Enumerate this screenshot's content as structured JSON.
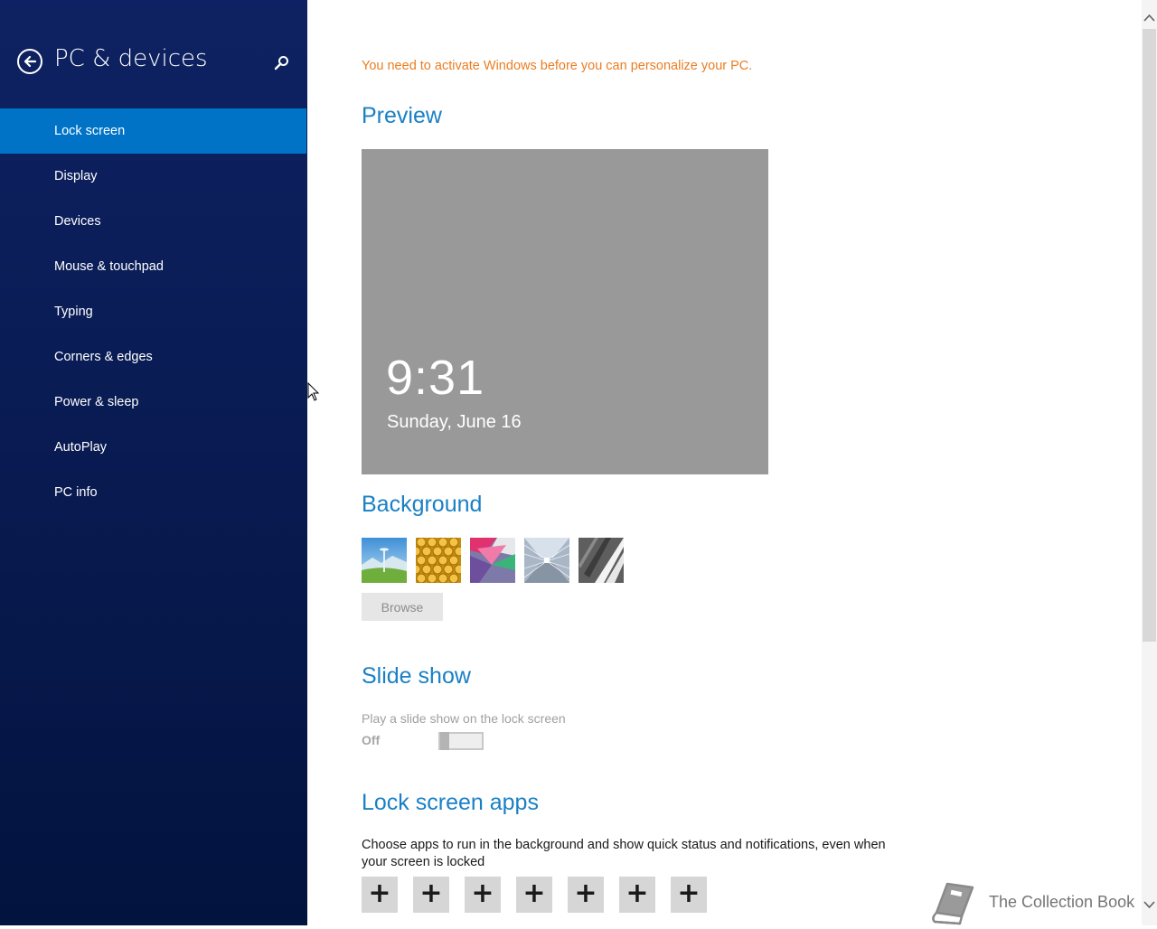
{
  "sidebar": {
    "title": "PC & devices",
    "items": [
      {
        "label": "Lock screen",
        "selected": true
      },
      {
        "label": "Display"
      },
      {
        "label": "Devices"
      },
      {
        "label": "Mouse & touchpad"
      },
      {
        "label": "Typing"
      },
      {
        "label": "Corners & edges"
      },
      {
        "label": "Power & sleep"
      },
      {
        "label": "AutoPlay"
      },
      {
        "label": "PC info"
      }
    ]
  },
  "main": {
    "activation_warning": "You need to activate Windows before you can personalize your PC.",
    "preview": {
      "heading": "Preview",
      "time": "9:31",
      "date": "Sunday, June 16"
    },
    "background": {
      "heading": "Background",
      "thumbnails": [
        "space-needle-landscape",
        "honeycomb",
        "geometric-shapes",
        "glass-tunnel",
        "piano-keys"
      ],
      "browse_label": "Browse"
    },
    "slide_show": {
      "heading": "Slide show",
      "description": "Play a slide show on the lock screen",
      "state": "Off",
      "enabled": false
    },
    "lock_screen_apps": {
      "heading": "Lock screen apps",
      "description": "Choose apps to run in the background and show quick status and notifications, even when your screen is locked",
      "slots": [
        "+",
        "+",
        "+",
        "+",
        "+",
        "+",
        "+"
      ]
    }
  },
  "watermark": {
    "text": "The Collection Book"
  },
  "colors": {
    "sidebar_bg": "#0a1c52",
    "selected_item": "#0173c7",
    "heading": "#1a80c5",
    "warning": "#eb7d22",
    "preview_bg": "#999999"
  }
}
